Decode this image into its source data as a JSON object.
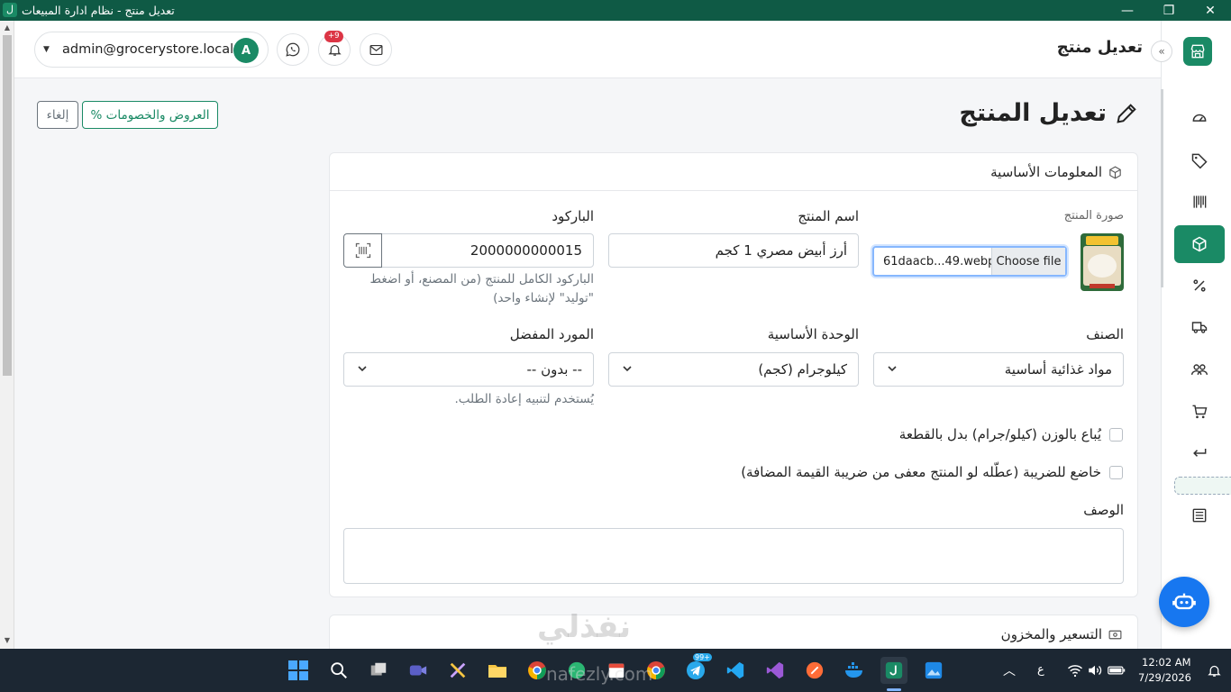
{
  "window": {
    "title": "تعديل منتج - نظام ادارة المبيعات",
    "app_icon": "ل",
    "minimize": "—",
    "restore": "❐",
    "close": "✕"
  },
  "header": {
    "title": "تعديل منتج",
    "user_email": "admin@grocerystore.local",
    "avatar_letter": "A",
    "notification_badge": "+9"
  },
  "page": {
    "title": "تعديل المنتج",
    "offers_button": "% العروض والخصومات",
    "cancel_button": "إلغاء"
  },
  "basic_info": {
    "section_title": "المعلومات الأساسية",
    "image_label": "صورة المنتج",
    "file_name": "61daacb...49.webp",
    "choose_file": "Choose file",
    "name_label": "اسم المنتج",
    "name_value": "أرز أبيض مصري 1 كجم",
    "barcode_label": "الباركود",
    "barcode_value": "2000000000015",
    "barcode_help": "الباركود الكامل للمنتج (من المصنع، أو اضغط \"توليد\" لإنشاء واحد)",
    "category_label": "الصنف",
    "category_value": "مواد غذائية أساسية",
    "unit_label": "الوحدة الأساسية",
    "unit_value": "كيلوجرام (كجم)",
    "supplier_label": "المورد المفضل",
    "supplier_value": "-- بدون --",
    "supplier_help": "يُستخدم لتنبيه إعادة الطلب.",
    "sold_by_weight": "يُباع بالوزن (كيلو/جرام) بدل بالقطعة",
    "taxable": "خاضع للضريبة (عطّله لو المنتج معفى من ضريبة القيمة المضافة)",
    "description_label": "الوصف"
  },
  "pricing": {
    "section_title": "التسعير والمخزون"
  },
  "watermark": {
    "arabic": "نفذلي",
    "latin": "nafezly.com"
  },
  "taskbar": {
    "time": "12:02 AM",
    "date": "7/29/2026",
    "lang": "ع",
    "telegram_badge": "99+"
  },
  "colors": {
    "brand": "#1a8a65",
    "titlebar": "#0f5a45",
    "taskbar": "#1c2733",
    "bot": "#1777f0"
  },
  "icons": {
    "sidebar": [
      "store-icon",
      "dashboard-icon",
      "tag-icon",
      "barcode-icon",
      "box-icon",
      "percent-icon",
      "truck-icon",
      "users-icon",
      "cart-icon",
      "return-icon",
      "report-icon"
    ]
  }
}
